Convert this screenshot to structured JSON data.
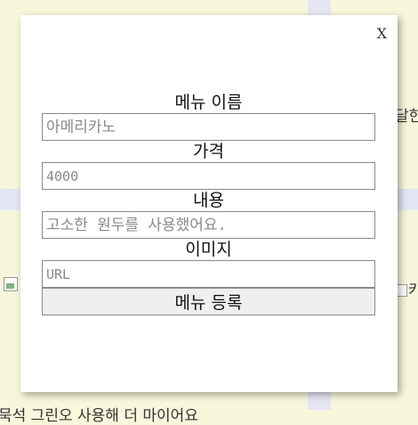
{
  "background": {
    "right_text": "달한",
    "right_img_text": "카",
    "bottom_text": "묵석 그린오 사용해 더 마이어요"
  },
  "modal": {
    "close_label": "X",
    "fields": [
      {
        "label": "메뉴 이름",
        "placeholder": "아메리카노"
      },
      {
        "label": "가격",
        "placeholder": "4000"
      },
      {
        "label": "내용",
        "placeholder": "고소한 원두를 사용했어요."
      },
      {
        "label": "이미지",
        "placeholder": "URL"
      }
    ],
    "submit_label": "메뉴 등록"
  }
}
